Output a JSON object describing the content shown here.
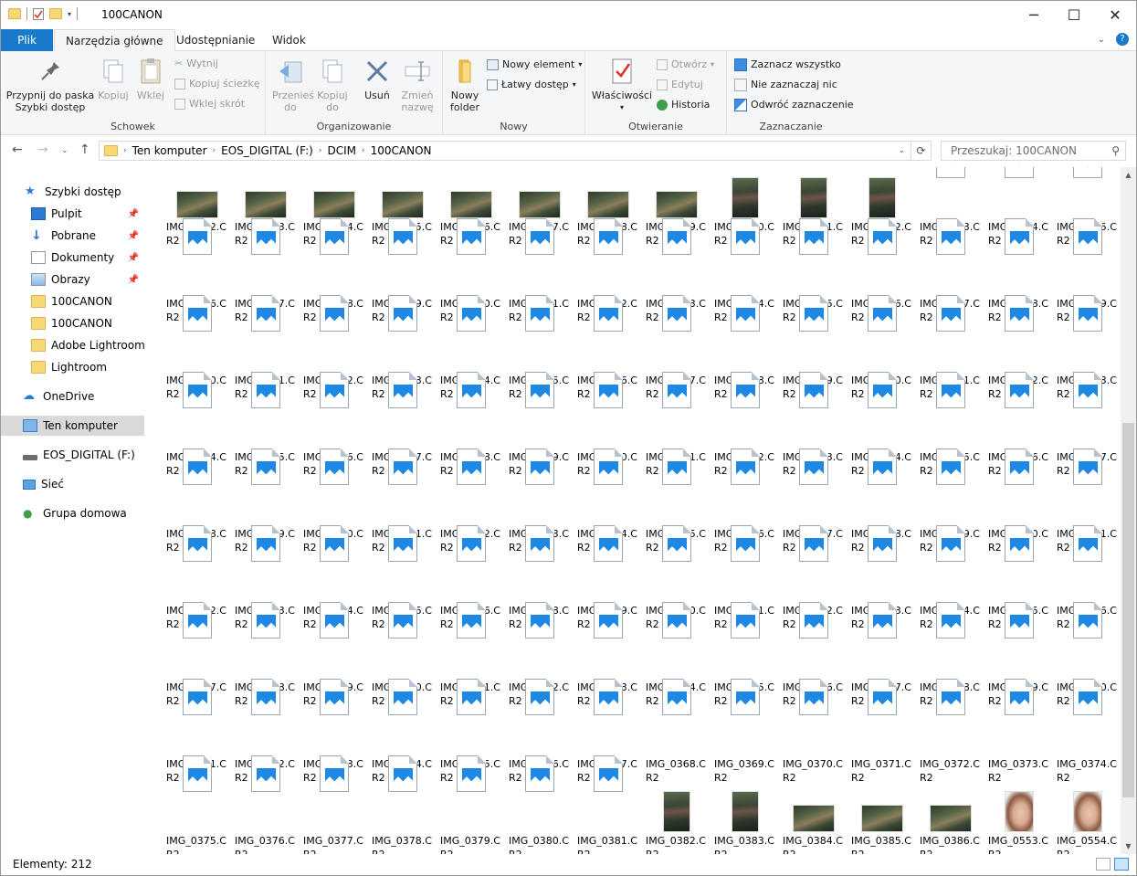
{
  "window": {
    "title": "100CANON",
    "minimize": "─",
    "maximize": "☐",
    "close": "✕"
  },
  "tabs": {
    "file": "Plik",
    "home": "Narzędzia główne",
    "share": "Udostępnianie",
    "view": "Widok"
  },
  "ribbon": {
    "clipboard": {
      "group": "Schowek",
      "pin": "Przypnij do paska Szybki dostęp",
      "copy": "Kopiuj",
      "paste": "Wklej",
      "cut": "Wytnij",
      "copy_path": "Kopiuj ścieżkę",
      "paste_shortcut": "Wklej skrót"
    },
    "organize": {
      "group": "Organizowanie",
      "move_to": "Przenieś do",
      "copy_to": "Kopiuj do",
      "delete": "Usuń",
      "rename": "Zmień nazwę"
    },
    "new": {
      "group": "Nowy",
      "new_folder": "Nowy folder",
      "new_item": "Nowy element",
      "easy_access": "Łatwy dostęp"
    },
    "open": {
      "group": "Otwieranie",
      "properties": "Właściwości",
      "open": "Otwórz",
      "edit": "Edytuj",
      "history": "Historia"
    },
    "select": {
      "group": "Zaznaczanie",
      "select_all": "Zaznacz wszystko",
      "select_none": "Nie zaznaczaj nic",
      "invert": "Odwróć zaznaczenie"
    }
  },
  "address": {
    "crumbs": [
      "Ten komputer",
      "EOS_DIGITAL (F:)",
      "DCIM",
      "100CANON"
    ],
    "search_placeholder": "Przeszukaj: 100CANON"
  },
  "nav": {
    "quick_access": "Szybki dostęp",
    "desktop": "Pulpit",
    "downloads": "Pobrane",
    "documents": "Dokumenty",
    "pictures": "Obrazy",
    "folder1": "100CANON",
    "folder2": "100CANON",
    "folder3": "Adobe Lightroom",
    "folder4": "Lightroom",
    "onedrive": "OneDrive",
    "this_pc": "Ten komputer",
    "drive": "EOS_DIGITAL (F:)",
    "network": "Sieć",
    "homegroup": "Grupa domowa"
  },
  "files": [
    {
      "name": "IMG_0262.CR2",
      "thumb": "land"
    },
    {
      "name": "IMG_0263.CR2",
      "thumb": "land"
    },
    {
      "name": "IMG_0264.CR2",
      "thumb": "land"
    },
    {
      "name": "IMG_0265.CR2",
      "thumb": "land"
    },
    {
      "name": "IMG_0266.CR2",
      "thumb": "land"
    },
    {
      "name": "IMG_0267.CR2",
      "thumb": "land"
    },
    {
      "name": "IMG_0268.CR2",
      "thumb": "land"
    },
    {
      "name": "IMG_0269.CR2",
      "thumb": "land"
    },
    {
      "name": "IMG_0270.CR2",
      "thumb": "port"
    },
    {
      "name": "IMG_0271.CR2",
      "thumb": "port"
    },
    {
      "name": "IMG_0272.CR2",
      "thumb": "port"
    },
    {
      "name": "IMG_0273.CR2",
      "thumb": "icon"
    },
    {
      "name": "IMG_0274.CR2",
      "thumb": "icon"
    },
    {
      "name": "IMG_0275.CR2",
      "thumb": "icon"
    },
    {
      "name": "IMG_0276.CR2",
      "thumb": "icon"
    },
    {
      "name": "IMG_0277.CR2",
      "thumb": "icon"
    },
    {
      "name": "IMG_0278.CR2",
      "thumb": "icon"
    },
    {
      "name": "IMG_0279.CR2",
      "thumb": "icon"
    },
    {
      "name": "IMG_0280.CR2",
      "thumb": "icon"
    },
    {
      "name": "IMG_0281.CR2",
      "thumb": "icon"
    },
    {
      "name": "IMG_0282.CR2",
      "thumb": "icon"
    },
    {
      "name": "IMG_0283.CR2",
      "thumb": "icon"
    },
    {
      "name": "IMG_0284.CR2",
      "thumb": "icon"
    },
    {
      "name": "IMG_0285.CR2",
      "thumb": "icon"
    },
    {
      "name": "IMG_0286.CR2",
      "thumb": "icon"
    },
    {
      "name": "IMG_0287.CR2",
      "thumb": "icon"
    },
    {
      "name": "IMG_0288.CR2",
      "thumb": "icon"
    },
    {
      "name": "IMG_0289.CR2",
      "thumb": "icon"
    },
    {
      "name": "IMG_0290.CR2",
      "thumb": "icon"
    },
    {
      "name": "IMG_0291.CR2",
      "thumb": "icon"
    },
    {
      "name": "IMG_0292.CR2",
      "thumb": "icon"
    },
    {
      "name": "IMG_0293.CR2",
      "thumb": "icon"
    },
    {
      "name": "IMG_0294.CR2",
      "thumb": "icon"
    },
    {
      "name": "IMG_0295.CR2",
      "thumb": "icon"
    },
    {
      "name": "IMG_0296.CR2",
      "thumb": "icon"
    },
    {
      "name": "IMG_0297.CR2",
      "thumb": "icon"
    },
    {
      "name": "IMG_0298.CR2",
      "thumb": "icon"
    },
    {
      "name": "IMG_0299.CR2",
      "thumb": "icon"
    },
    {
      "name": "IMG_0300.CR2",
      "thumb": "icon"
    },
    {
      "name": "IMG_0301.CR2",
      "thumb": "icon"
    },
    {
      "name": "IMG_0302.CR2",
      "thumb": "icon"
    },
    {
      "name": "IMG_0303.CR2",
      "thumb": "icon"
    },
    {
      "name": "IMG_0304.CR2",
      "thumb": "icon"
    },
    {
      "name": "IMG_0305.CR2",
      "thumb": "icon"
    },
    {
      "name": "IMG_0306.CR2",
      "thumb": "icon"
    },
    {
      "name": "IMG_0307.CR2",
      "thumb": "icon"
    },
    {
      "name": "IMG_0308.CR2",
      "thumb": "icon"
    },
    {
      "name": "IMG_0309.CR2",
      "thumb": "icon"
    },
    {
      "name": "IMG_0310.CR2",
      "thumb": "icon"
    },
    {
      "name": "IMG_0311.CR2",
      "thumb": "icon"
    },
    {
      "name": "IMG_0312.CR2",
      "thumb": "icon"
    },
    {
      "name": "IMG_0313.CR2",
      "thumb": "icon"
    },
    {
      "name": "IMG_0314.CR2",
      "thumb": "icon"
    },
    {
      "name": "IMG_0315.CR2",
      "thumb": "icon"
    },
    {
      "name": "IMG_0316.CR2",
      "thumb": "icon"
    },
    {
      "name": "IMG_0317.CR2",
      "thumb": "icon"
    },
    {
      "name": "IMG_0318.CR2",
      "thumb": "icon"
    },
    {
      "name": "IMG_0319.CR2",
      "thumb": "icon"
    },
    {
      "name": "IMG_0320.CR2",
      "thumb": "icon"
    },
    {
      "name": "IMG_0321.CR2",
      "thumb": "icon"
    },
    {
      "name": "IMG_0322.CR2",
      "thumb": "icon"
    },
    {
      "name": "IMG_0323.CR2",
      "thumb": "icon"
    },
    {
      "name": "IMG_0324.CR2",
      "thumb": "icon"
    },
    {
      "name": "IMG_0325.CR2",
      "thumb": "icon"
    },
    {
      "name": "IMG_0326.CR2",
      "thumb": "icon"
    },
    {
      "name": "IMG_0327.CR2",
      "thumb": "icon"
    },
    {
      "name": "IMG_0328.CR2",
      "thumb": "icon"
    },
    {
      "name": "IMG_0329.CR2",
      "thumb": "icon"
    },
    {
      "name": "IMG_0330.CR2",
      "thumb": "icon"
    },
    {
      "name": "IMG_0331.CR2",
      "thumb": "icon"
    },
    {
      "name": "IMG_0332.CR2",
      "thumb": "icon"
    },
    {
      "name": "IMG_0333.CR2",
      "thumb": "icon"
    },
    {
      "name": "IMG_0334.CR2",
      "thumb": "icon"
    },
    {
      "name": "IMG_0335.CR2",
      "thumb": "icon"
    },
    {
      "name": "IMG_0336.CR2",
      "thumb": "icon"
    },
    {
      "name": "IMG_0338.CR2",
      "thumb": "icon"
    },
    {
      "name": "IMG_0339.CR2",
      "thumb": "icon"
    },
    {
      "name": "IMG_0340.CR2",
      "thumb": "icon"
    },
    {
      "name": "IMG_0341.CR2",
      "thumb": "icon"
    },
    {
      "name": "IMG_0342.CR2",
      "thumb": "icon"
    },
    {
      "name": "IMG_0343.CR2",
      "thumb": "icon"
    },
    {
      "name": "IMG_0344.CR2",
      "thumb": "icon"
    },
    {
      "name": "IMG_0345.CR2",
      "thumb": "icon"
    },
    {
      "name": "IMG_0346.CR2",
      "thumb": "icon"
    },
    {
      "name": "IMG_0347.CR2",
      "thumb": "icon"
    },
    {
      "name": "IMG_0348.CR2",
      "thumb": "icon"
    },
    {
      "name": "IMG_0349.CR2",
      "thumb": "icon"
    },
    {
      "name": "IMG_0350.CR2",
      "thumb": "icon"
    },
    {
      "name": "IMG_0351.CR2",
      "thumb": "icon"
    },
    {
      "name": "IMG_0352.CR2",
      "thumb": "icon"
    },
    {
      "name": "IMG_0353.CR2",
      "thumb": "icon"
    },
    {
      "name": "IMG_0354.CR2",
      "thumb": "icon"
    },
    {
      "name": "IMG_0355.CR2",
      "thumb": "icon"
    },
    {
      "name": "IMG_0356.CR2",
      "thumb": "icon"
    },
    {
      "name": "IMG_0357.CR2",
      "thumb": "icon"
    },
    {
      "name": "IMG_0358.CR2",
      "thumb": "icon"
    },
    {
      "name": "IMG_0359.CR2",
      "thumb": "icon"
    },
    {
      "name": "IMG_0360.CR2",
      "thumb": "icon"
    },
    {
      "name": "IMG_0361.CR2",
      "thumb": "icon"
    },
    {
      "name": "IMG_0362.CR2",
      "thumb": "icon"
    },
    {
      "name": "IMG_0363.CR2",
      "thumb": "icon"
    },
    {
      "name": "IMG_0364.CR2",
      "thumb": "icon"
    },
    {
      "name": "IMG_0365.CR2",
      "thumb": "icon"
    },
    {
      "name": "IMG_0366.CR2",
      "thumb": "icon"
    },
    {
      "name": "IMG_0367.CR2",
      "thumb": "icon"
    },
    {
      "name": "IMG_0368.CR2",
      "thumb": "icon"
    },
    {
      "name": "IMG_0369.CR2",
      "thumb": "icon"
    },
    {
      "name": "IMG_0370.CR2",
      "thumb": "icon"
    },
    {
      "name": "IMG_0371.CR2",
      "thumb": "icon"
    },
    {
      "name": "IMG_0372.CR2",
      "thumb": "icon"
    },
    {
      "name": "IMG_0373.CR2",
      "thumb": "icon"
    },
    {
      "name": "IMG_0374.CR2",
      "thumb": "icon"
    },
    {
      "name": "IMG_0375.CR2",
      "thumb": "icon"
    },
    {
      "name": "IMG_0376.CR2",
      "thumb": "icon"
    },
    {
      "name": "IMG_0377.CR2",
      "thumb": "icon"
    },
    {
      "name": "IMG_0378.CR2",
      "thumb": "icon"
    },
    {
      "name": "IMG_0379.CR2",
      "thumb": "icon"
    },
    {
      "name": "IMG_0380.CR2",
      "thumb": "icon"
    },
    {
      "name": "IMG_0381.CR2",
      "thumb": "icon"
    },
    {
      "name": "IMG_0382.CR2",
      "thumb": "port"
    },
    {
      "name": "IMG_0383.CR2",
      "thumb": "port"
    },
    {
      "name": "IMG_0384.CR2",
      "thumb": "land"
    },
    {
      "name": "IMG_0385.CR2",
      "thumb": "land"
    },
    {
      "name": "IMG_0386.CR2",
      "thumb": "land"
    },
    {
      "name": "IMG_0553.CR2",
      "thumb": "face"
    },
    {
      "name": "IMG_0554.CR2",
      "thumb": "face"
    }
  ],
  "status": {
    "count": "Elementy: 212"
  },
  "colors": {
    "accent": "#1979ca",
    "selection": "#d9d9d9"
  }
}
